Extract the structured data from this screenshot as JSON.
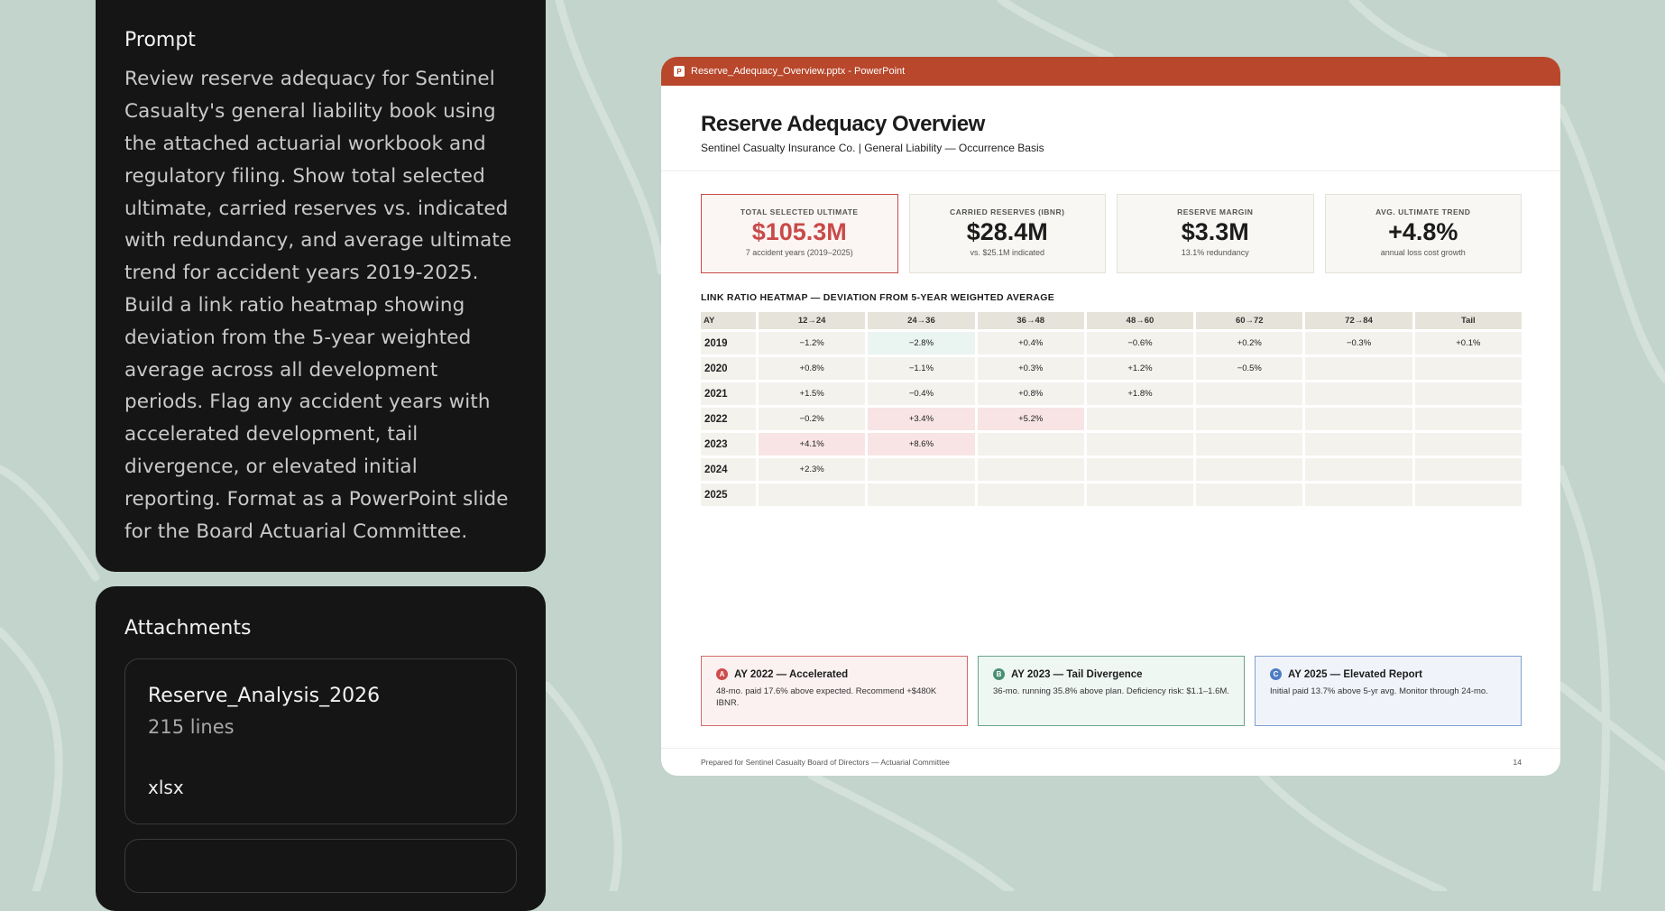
{
  "prompt": {
    "title": "Prompt",
    "text": "Review reserve adequacy for Sentinel Casualty's general liability book using the attached actuarial workbook and regulatory filing. Show total selected ultimate, carried reserves vs. indicated with redundancy, and average ultimate trend for accident years 2019-2025. Build a link ratio heatmap showing deviation from the 5-year weighted average across all development periods. Flag any accident years with accelerated development, tail divergence, or elevated initial reporting. Format as a PowerPoint slide for the Board Actuarial Committee."
  },
  "attachments": {
    "title": "Attachments",
    "items": [
      {
        "name": "Reserve_Analysis_2026",
        "lines": "215 lines",
        "ext": "xlsx"
      }
    ]
  },
  "window": {
    "title": "Reserve_Adequacy_Overview.pptx - PowerPoint",
    "app_icon": "P"
  },
  "slide": {
    "title": "Reserve Adequacy Overview",
    "subtitle": "Sentinel Casualty Insurance Co.  |  General Liability — Occurrence Basis",
    "kpis": [
      {
        "label": "TOTAL SELECTED ULTIMATE",
        "value": "$105.3M",
        "sub": "7 accident years (2019–2025)"
      },
      {
        "label": "CARRIED RESERVES (IBNR)",
        "value": "$28.4M",
        "sub": "vs. $25.1M indicated"
      },
      {
        "label": "RESERVE MARGIN",
        "value": "$3.3M",
        "sub": "13.1% redundancy"
      },
      {
        "label": "AVG. ULTIMATE TREND",
        "value": "+4.8%",
        "sub": "annual loss cost growth"
      }
    ],
    "heatmap_title": "LINK RATIO HEATMAP — DEVIATION FROM 5-YEAR WEIGHTED AVERAGE",
    "heatmap": {
      "columns": [
        "AY",
        "12→24",
        "24→36",
        "36→48",
        "48→60",
        "60→72",
        "72→84",
        "Tail"
      ],
      "rows": [
        {
          "ay": "2019",
          "cells": [
            "−1.2%",
            "−2.8%",
            "+0.4%",
            "−0.6%",
            "+0.2%",
            "−0.3%",
            "+0.1%"
          ]
        },
        {
          "ay": "2020",
          "cells": [
            "+0.8%",
            "−1.1%",
            "+0.3%",
            "+1.2%",
            "−0.5%",
            "",
            ""
          ]
        },
        {
          "ay": "2021",
          "cells": [
            "+1.5%",
            "−0.4%",
            "+0.8%",
            "+1.8%",
            "",
            "",
            ""
          ]
        },
        {
          "ay": "2022",
          "cells": [
            "−0.2%",
            "+3.4%",
            "+5.2%",
            "",
            "",
            "",
            ""
          ]
        },
        {
          "ay": "2023",
          "cells": [
            "+4.1%",
            "+8.6%",
            "",
            "",
            "",
            "",
            ""
          ]
        },
        {
          "ay": "2024",
          "cells": [
            "+2.3%",
            "",
            "",
            "",
            "",
            "",
            ""
          ]
        },
        {
          "ay": "2025",
          "cells": [
            "",
            "",
            "",
            "",
            "",
            "",
            ""
          ]
        }
      ],
      "highlight_colors": {
        "favorable": "#eaf4f0",
        "adverse": "#f8e4e4"
      }
    },
    "flags": [
      {
        "badge": "A",
        "title": "AY 2022 — Accelerated",
        "body": "48-mo. paid 17.6% above expected. Recommend +$480K IBNR."
      },
      {
        "badge": "B",
        "title": "AY 2023 — Tail Divergence",
        "body": "36-mo. running 35.8% above plan. Deficiency risk: $1.1–1.6M."
      },
      {
        "badge": "C",
        "title": "AY 2025 — Elevated Report",
        "body": "Initial paid 13.7% above 5-yr avg. Monitor through 24-mo."
      }
    ],
    "footer_left": "Prepared for Sentinel Casualty Board of Directors — Actuarial Committee",
    "page_number": "14"
  },
  "colors": {
    "background": "#c2d4cb",
    "titlebar": "#b8472b",
    "accent_red": "#c94a4a"
  }
}
